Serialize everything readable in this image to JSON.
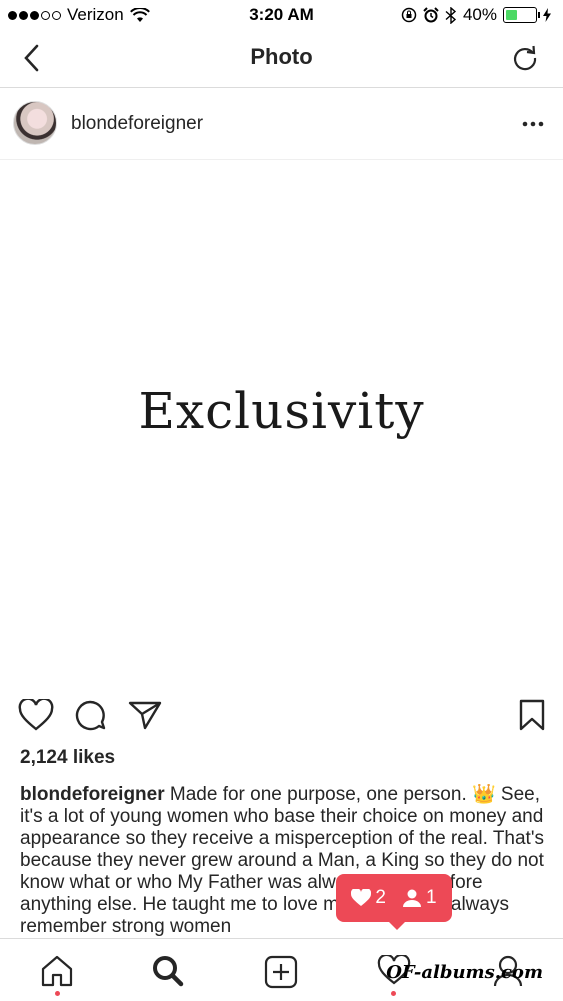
{
  "status_bar": {
    "carrier": "Verizon",
    "time": "3:20 AM",
    "battery_percent": "40%",
    "battery_level": 0.4
  },
  "nav": {
    "title": "Photo",
    "back_icon": "chevron-left-icon",
    "refresh_icon": "refresh-icon"
  },
  "post": {
    "username": "blondeforeigner",
    "more_icon": "more-horizontal-icon",
    "image_text": "Exclusivity",
    "likes": "2,124 likes",
    "caption_user": "blondeforeigner",
    "caption_text": "Made for one purpose, one person. 👑 See, it's a lot of young women who base their choice on money and appearance so they receive a misperception of the real. That's because they never grew around a Man, a King so they do not know what or who My Father was always a Man before anything else. He taught me to love myself first but always remember strong women"
  },
  "notification": {
    "likes_count": "2",
    "follows_count": "1"
  },
  "tabbar": {
    "items": [
      "home-icon",
      "search-icon",
      "add-icon",
      "heart-icon",
      "profile-icon"
    ]
  },
  "watermark": "OF-albums.com",
  "colors": {
    "accent": "#ed4956",
    "border": "#dbdbdb",
    "text": "#262626"
  }
}
